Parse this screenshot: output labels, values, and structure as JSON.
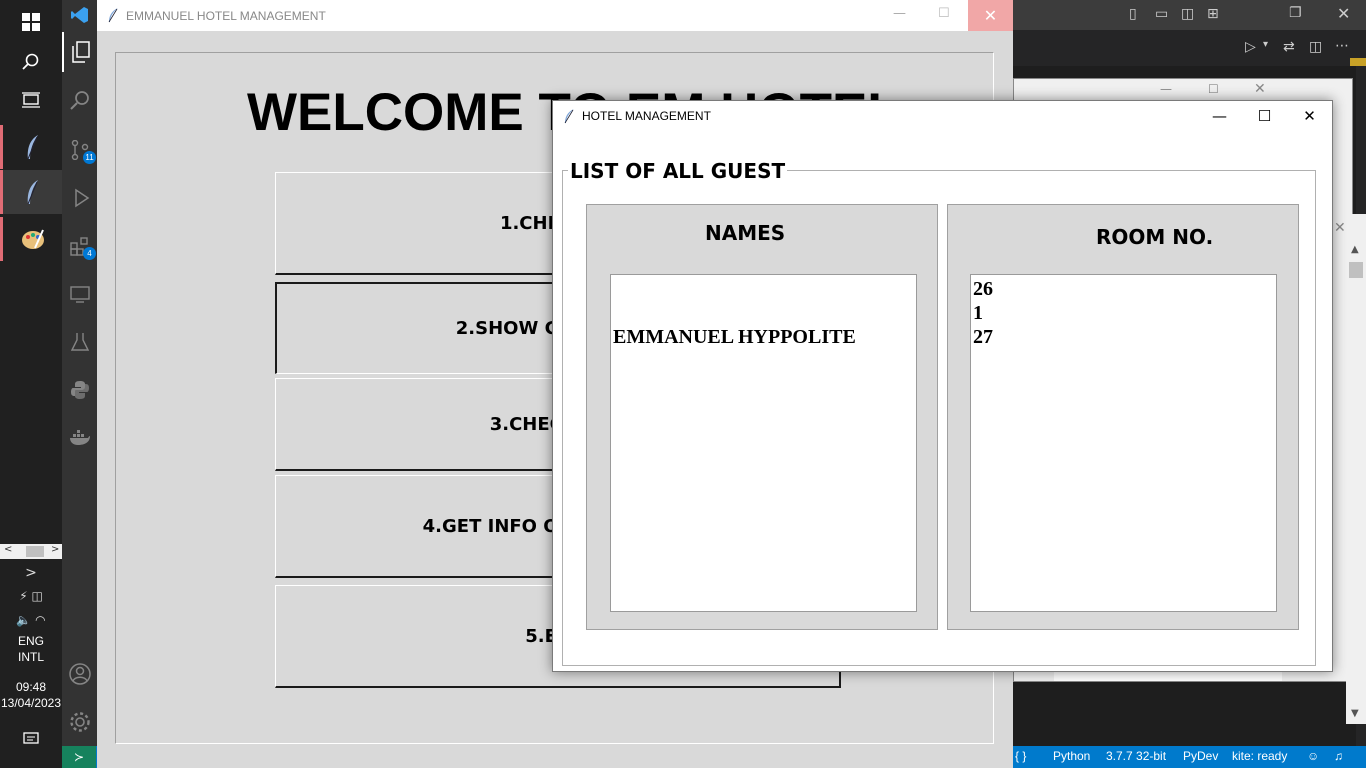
{
  "main_window": {
    "title": "EMMANUEL HOTEL MANAGEMENT",
    "heading": "WELCOME TO EM HOTEL",
    "buttons": [
      {
        "label": "1.CHECK IN"
      },
      {
        "label": "2.SHOW GUEST LIST"
      },
      {
        "label": "3.CHECK OUT"
      },
      {
        "label": "4.GET INFO OF ANY GUEST"
      },
      {
        "label": "5.EXIT"
      }
    ]
  },
  "guest_window": {
    "title": "HOTEL MANAGEMENT",
    "frame_label": "LIST OF ALL GUEST",
    "names_header": "NAMES",
    "rooms_header": "ROOM NO.",
    "names": [
      "",
      "",
      "EMMANUEL HYPPOLITE"
    ],
    "rooms": [
      "26",
      "1",
      "27"
    ]
  },
  "taskbar": {
    "language": "ENG",
    "layout": "INTL",
    "time": "09:48",
    "date": "13/04/2023"
  },
  "statusbar": {
    "items": [
      "Python",
      "3.7.7 32-bit",
      "PyDev",
      "kite: ready"
    ]
  },
  "colors": {
    "tk_bg": "#d9d9d9",
    "vscode_status": "#007acc",
    "close_hover": "#f1a7a7"
  }
}
